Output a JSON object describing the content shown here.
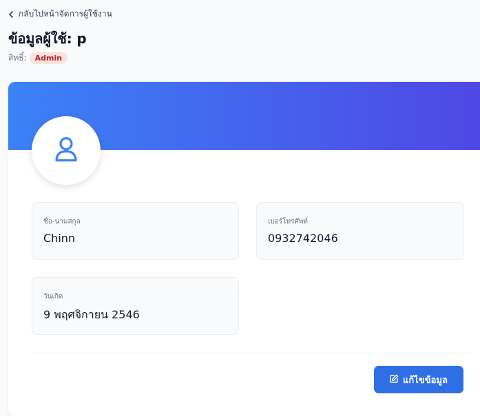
{
  "nav": {
    "back_label": "กลับไปหน้าจัดการผู้ใช้งาน"
  },
  "header": {
    "title": "ข้อมูลผู้ใช้: p",
    "role_label": "สิทธิ์:",
    "role_value": "Admin"
  },
  "profile": {
    "fields": [
      {
        "label": "ชื่อ-นามสกุล",
        "value": "Chinn"
      },
      {
        "label": "เบอร์โทรศัพท์",
        "value": "0932742046"
      },
      {
        "label": "วันเกิด",
        "value": "9 พฤศจิกายน 2546"
      }
    ]
  },
  "actions": {
    "edit_label": "แก้ไขข้อมูล"
  },
  "colors": {
    "banner_start": "#3b82f6",
    "banner_end": "#4f46e5",
    "primary": "#2f6fe5",
    "badge_bg": "#fde2e2",
    "badge_text": "#b42323"
  },
  "icons": {
    "back": "chevron-left-icon",
    "avatar": "user-icon",
    "edit": "edit-icon"
  }
}
